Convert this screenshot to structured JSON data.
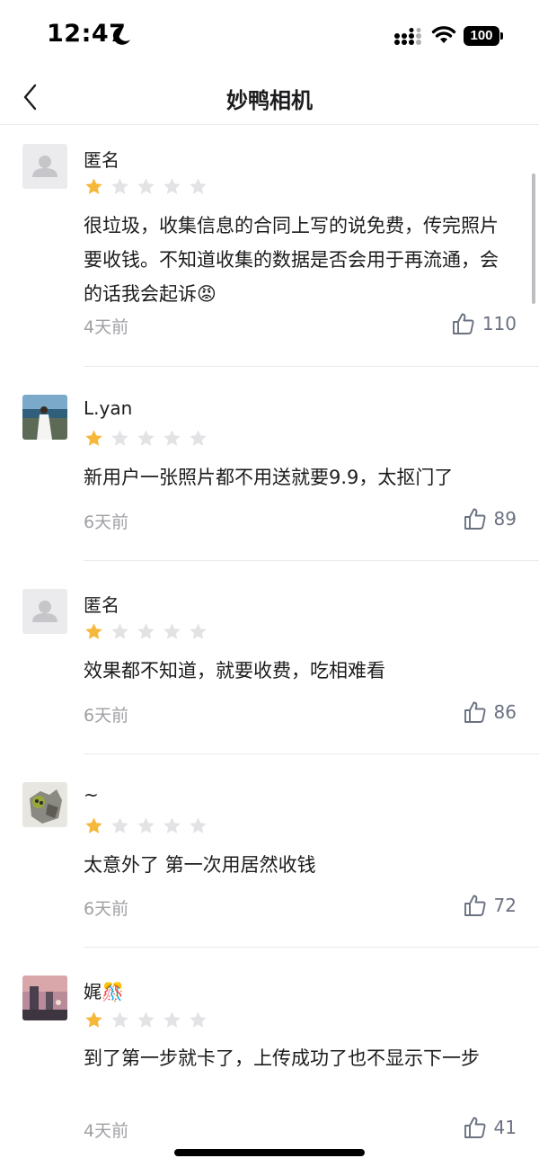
{
  "status_bar": {
    "time": "12:47",
    "battery": "100"
  },
  "nav": {
    "title": "妙鸭相机"
  },
  "colors": {
    "star_filled": "#f5b83a",
    "star_empty": "#e3e3e6",
    "meta_gray": "#a0a0a5"
  },
  "reviews": [
    {
      "user": "匿名",
      "rating": 1,
      "text": "很垃圾，收集信息的合同上写的说免费，传完照片要收钱。不知道收集的数据是否会用于再流通，会的话我会起诉😡",
      "time": "4天前",
      "likes": "110"
    },
    {
      "user": "L.yan",
      "rating": 1,
      "text": "新用户一张照片都不用送就要9.9，太抠门了",
      "time": "6天前",
      "likes": "89"
    },
    {
      "user": "匿名",
      "rating": 1,
      "text": "效果都不知道，就要收费，吃相难看",
      "time": "6天前",
      "likes": "86"
    },
    {
      "user": "~",
      "rating": 1,
      "text": "太意外了 第一次用居然收钱",
      "time": "6天前",
      "likes": "72"
    },
    {
      "user": "娓🎊",
      "rating": 1,
      "text": "到了第一步就卡了，上传成功了也不显示下一步",
      "time": "4天前",
      "likes": "41"
    }
  ]
}
